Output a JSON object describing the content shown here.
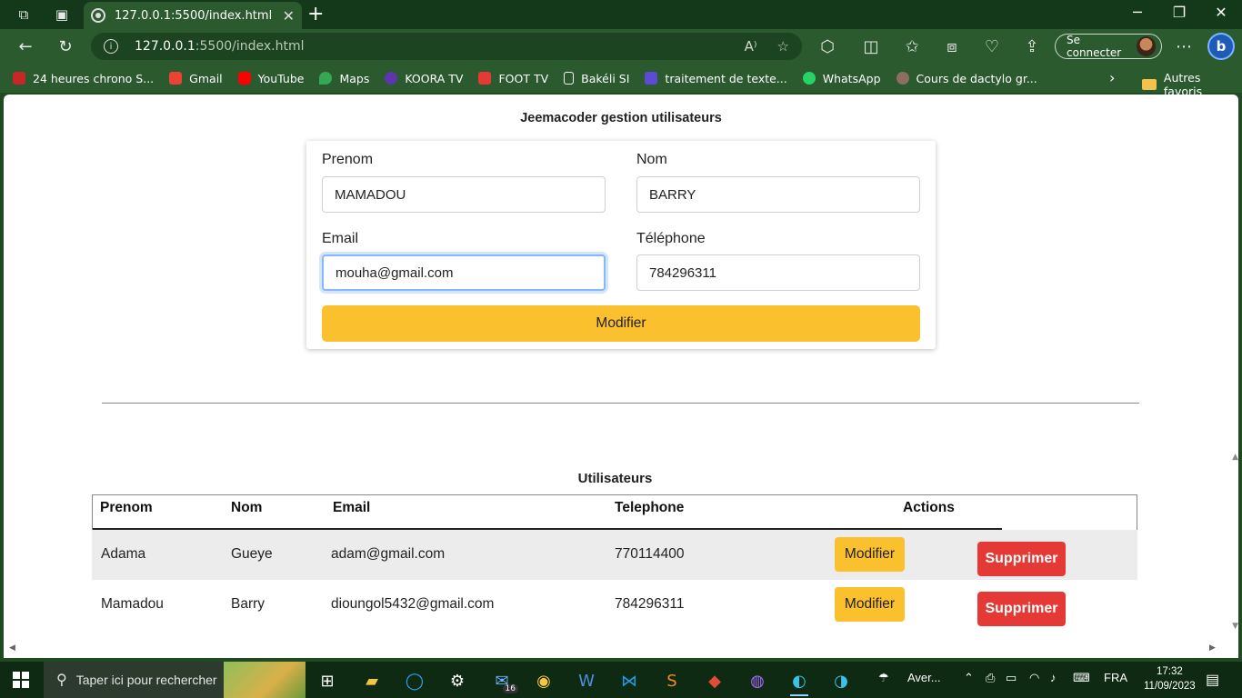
{
  "browser": {
    "tab_title": "127.0.0.1:5500/index.html",
    "url_host": "127.0.0.1",
    "url_path": ":5500/index.html",
    "signin_label": "Se connecter",
    "bing_label": "b"
  },
  "bookmarks": {
    "items": [
      {
        "label": "24 heures chrono S...",
        "color": "#c62828"
      },
      {
        "label": "Gmail",
        "color": "#ea4335"
      },
      {
        "label": "YouTube",
        "color": "#ff0000"
      },
      {
        "label": "Maps",
        "color": "#34a853"
      },
      {
        "label": "KOORA TV",
        "color": "#5e35b1"
      },
      {
        "label": "FOOT TV",
        "color": "#e53935"
      },
      {
        "label": "Bakéli SI",
        "color": "#ffffff"
      },
      {
        "label": "traitement de texte...",
        "color": "#5b4bd5"
      },
      {
        "label": "WhatsApp",
        "color": "#25d366"
      },
      {
        "label": "Cours de dactylo gr...",
        "color": "#8d6e63"
      }
    ],
    "other_label": "Autres favoris"
  },
  "page": {
    "title": "Jeemacoder gestion utilisateurs",
    "form": {
      "prenom_label": "Prenom",
      "prenom_value": "MAMADOU",
      "nom_label": "Nom",
      "nom_value": "BARRY",
      "email_label": "Email",
      "email_value": "mouha@gmail.com",
      "telephone_label": "Téléphone",
      "telephone_value": "784296311",
      "submit_label": "Modifier"
    },
    "table": {
      "caption": "Utilisateurs",
      "headers": {
        "prenom": "Prenom",
        "nom": "Nom",
        "email": "Email",
        "telephone": "Telephone",
        "actions": "Actions"
      },
      "rows": [
        {
          "prenom": "Adama",
          "nom": "Gueye",
          "email": "adam@gmail.com",
          "telephone": "770114400"
        },
        {
          "prenom": "Mamadou",
          "nom": "Barry",
          "email": "dioungol5432@gmail.com",
          "telephone": "784296311"
        }
      ],
      "edit_label": "Modifier",
      "delete_label": "Supprimer"
    },
    "colors": {
      "accent": "#fbc02d",
      "danger": "#e53935"
    }
  },
  "taskbar": {
    "search_placeholder": "Taper ici pour rechercher",
    "mail_badge": "16",
    "weather": "Aver...",
    "language": "FRA",
    "time": "17:32",
    "date": "11/09/2023"
  }
}
